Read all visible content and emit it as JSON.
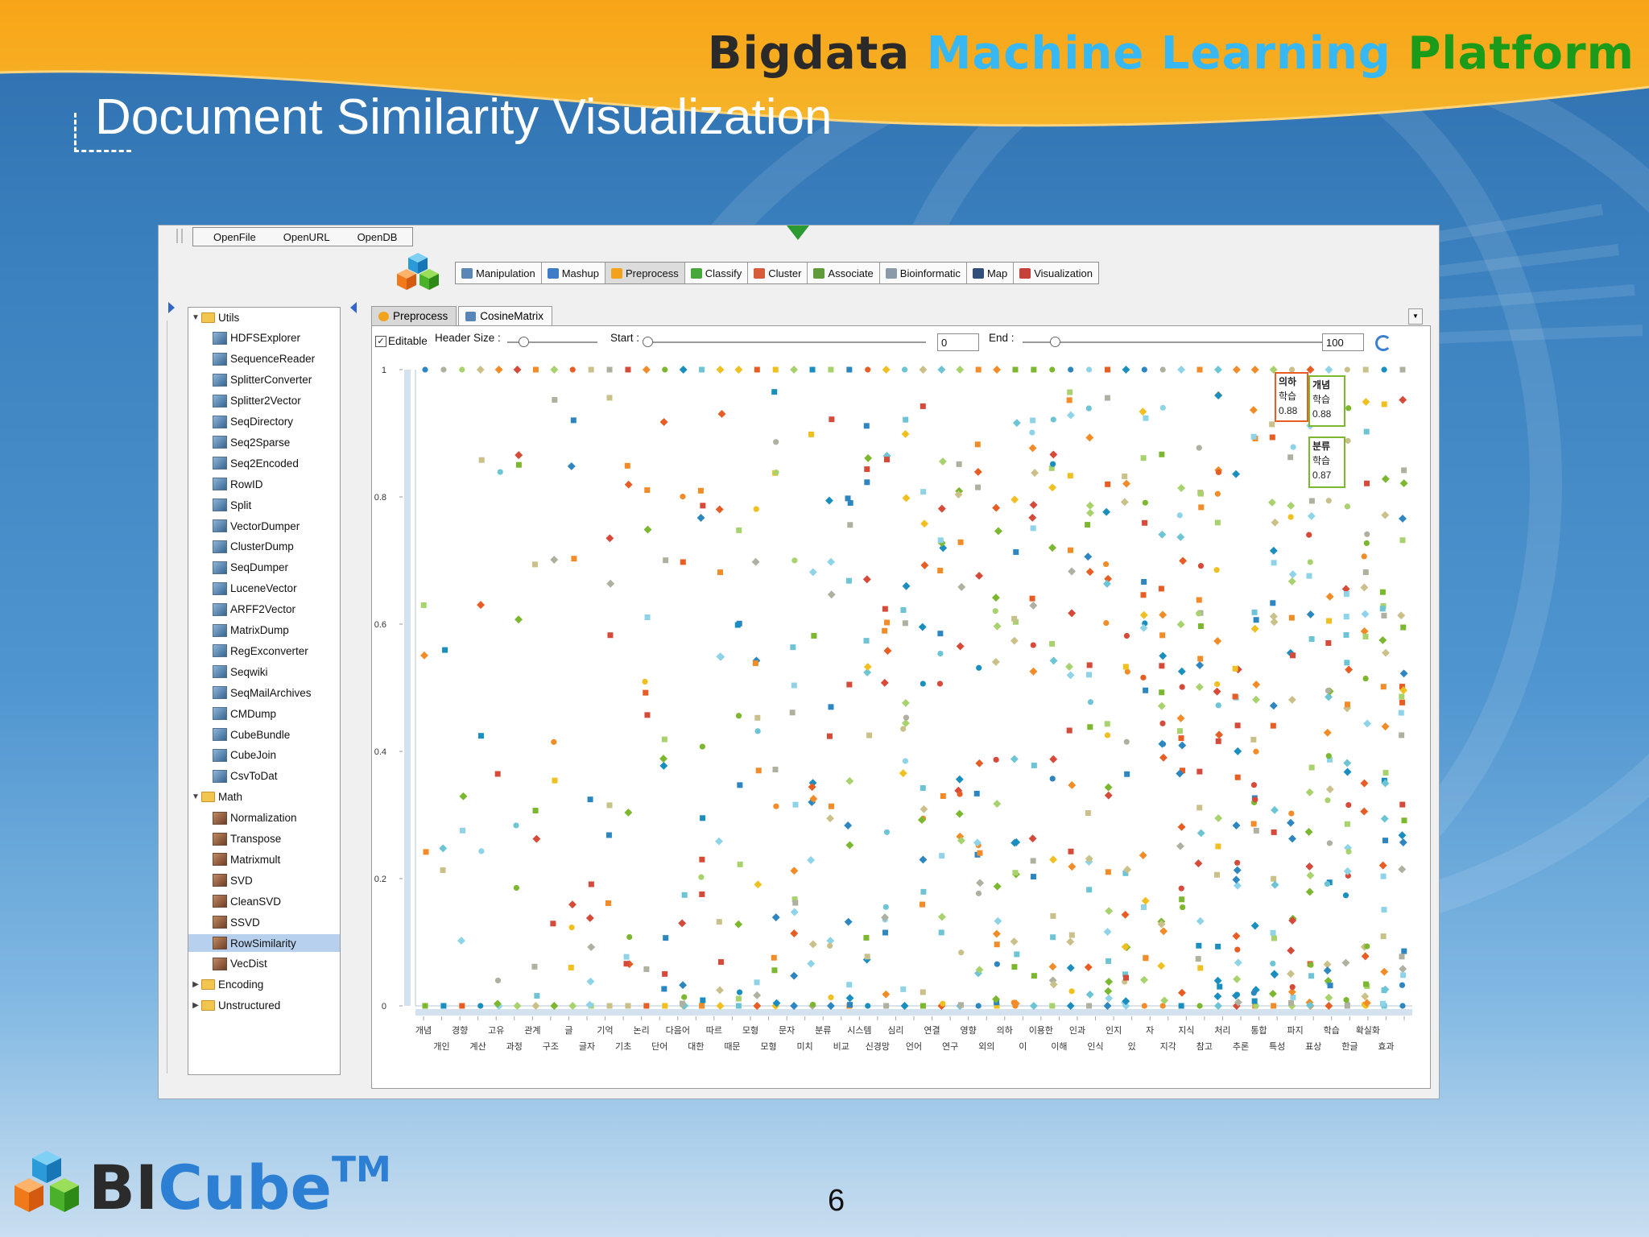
{
  "slide": {
    "brand_title": {
      "part1": "Bigdata",
      "part2": "Machine Learning",
      "part3": "Platform"
    },
    "title": "Document Similarity Visualization",
    "page_number": "6",
    "logo": {
      "text_bi": "BI",
      "text_cube": "Cube",
      "tm": "TM"
    }
  },
  "colors": {
    "accent_orange": "#f7a21b",
    "brand_blue": "#38b8f2",
    "brand_green": "#1a9c1a",
    "selection": "#b7d0ee"
  },
  "app": {
    "file_menu": [
      "OpenFile",
      "OpenURL",
      "OpenDB"
    ],
    "toolbar": [
      {
        "label": "Manipulation",
        "icon": "manipulation-icon",
        "active": false
      },
      {
        "label": "Mashup",
        "icon": "mashup-icon",
        "active": false
      },
      {
        "label": "Preprocess",
        "icon": "preprocess-icon",
        "active": true
      },
      {
        "label": "Classify",
        "icon": "classify-icon",
        "active": false
      },
      {
        "label": "Cluster",
        "icon": "cluster-icon",
        "active": false
      },
      {
        "label": "Associate",
        "icon": "associate-icon",
        "active": false
      },
      {
        "label": "Bioinformatic",
        "icon": "bioinformatic-icon",
        "active": false
      },
      {
        "label": "Map",
        "icon": "map-icon",
        "active": false
      },
      {
        "label": "Visualization",
        "icon": "visualization-icon",
        "active": false
      }
    ],
    "tree": [
      {
        "label": "Utils",
        "type": "folder",
        "expanded": true,
        "level": 0
      },
      {
        "label": "HDFSExplorer",
        "type": "util",
        "level": 1
      },
      {
        "label": "SequenceReader",
        "type": "util",
        "level": 1
      },
      {
        "label": "SplitterConverter",
        "type": "util",
        "level": 1
      },
      {
        "label": "Splitter2Vector",
        "type": "util",
        "level": 1
      },
      {
        "label": "SeqDirectory",
        "type": "util",
        "level": 1
      },
      {
        "label": "Seq2Sparse",
        "type": "util",
        "level": 1
      },
      {
        "label": "Seq2Encoded",
        "type": "util",
        "level": 1
      },
      {
        "label": "RowID",
        "type": "util",
        "level": 1
      },
      {
        "label": "Split",
        "type": "util",
        "level": 1
      },
      {
        "label": "VectorDumper",
        "type": "util",
        "level": 1
      },
      {
        "label": "ClusterDump",
        "type": "util",
        "level": 1
      },
      {
        "label": "SeqDumper",
        "type": "util",
        "level": 1
      },
      {
        "label": "LuceneVector",
        "type": "util",
        "level": 1
      },
      {
        "label": "ARFF2Vector",
        "type": "util",
        "level": 1
      },
      {
        "label": "MatrixDump",
        "type": "util",
        "level": 1
      },
      {
        "label": "RegExconverter",
        "type": "util",
        "level": 1
      },
      {
        "label": "Seqwiki",
        "type": "util",
        "level": 1
      },
      {
        "label": "SeqMailArchives",
        "type": "util",
        "level": 1
      },
      {
        "label": "CMDump",
        "type": "util",
        "level": 1
      },
      {
        "label": "CubeBundle",
        "type": "util",
        "level": 1
      },
      {
        "label": "CubeJoin",
        "type": "util",
        "level": 1
      },
      {
        "label": "CsvToDat",
        "type": "util",
        "level": 1
      },
      {
        "label": "Math",
        "type": "folder",
        "expanded": true,
        "level": 0
      },
      {
        "label": "Normalization",
        "type": "math",
        "level": 1
      },
      {
        "label": "Transpose",
        "type": "math",
        "level": 1
      },
      {
        "label": "Matrixmult",
        "type": "math",
        "level": 1
      },
      {
        "label": "SVD",
        "type": "math",
        "level": 1
      },
      {
        "label": "CleanSVD",
        "type": "math",
        "level": 1
      },
      {
        "label": "SSVD",
        "type": "math",
        "level": 1
      },
      {
        "label": "RowSimilarity",
        "type": "math",
        "level": 1,
        "selected": true
      },
      {
        "label": "VecDist",
        "type": "math",
        "level": 1
      },
      {
        "label": "Encoding",
        "type": "folder",
        "expanded": false,
        "level": 0
      },
      {
        "label": "Unstructured",
        "type": "folder",
        "expanded": false,
        "level": 0
      }
    ],
    "tabs": [
      {
        "label": "Preprocess",
        "active": true
      },
      {
        "label": "CosineMatrix",
        "active": false
      }
    ],
    "controls": {
      "editable_label": "Editable",
      "editable_checked": true,
      "header_size_label": "Header Size :",
      "start_label": "Start :",
      "start_value": "0",
      "end_label": "End :",
      "end_value": "100"
    }
  },
  "chart_data": {
    "type": "scatter",
    "ylim": [
      0,
      1
    ],
    "yticks": [
      "0",
      "0.2",
      "0.4",
      "0.6",
      "0.8",
      "1"
    ],
    "categories_row1": [
      "개념",
      "경향",
      "고유",
      "관계",
      "글",
      "기억",
      "논리",
      "다음어",
      "따르",
      "모형",
      "문자",
      "분류",
      "시스템",
      "심리",
      "연결",
      "영향",
      "의하",
      "이용한",
      "인과",
      "인지",
      "자",
      "지식",
      "처리",
      "통합",
      "파지",
      "학습",
      "확실화"
    ],
    "categories_row2": [
      "개인",
      "계산",
      "과정",
      "구조",
      "글자",
      "기초",
      "단어",
      "대한",
      "때문",
      "모형",
      "미치",
      "비교",
      "신경망",
      "언어",
      "연구",
      "외의",
      "이",
      "이해",
      "인식",
      "있",
      "지각",
      "참고",
      "추론",
      "특성",
      "표상",
      "한글",
      "효과"
    ],
    "tooltips": [
      {
        "word": "의하",
        "sub": "학습",
        "value": "0.88"
      },
      {
        "word": "개념",
        "sub": "학습",
        "value": "0.88"
      },
      {
        "word": "분류",
        "sub": "학습",
        "value": "0.87"
      }
    ],
    "series_colors": [
      "#2e86c1",
      "#f0c020",
      "#7cb82f",
      "#e85d24",
      "#8fd3e8",
      "#c9c08a",
      "#1a8fbf",
      "#d64a3a",
      "#a8d26e",
      "#f28c28",
      "#6cc4d4",
      "#b0b0a0"
    ]
  }
}
